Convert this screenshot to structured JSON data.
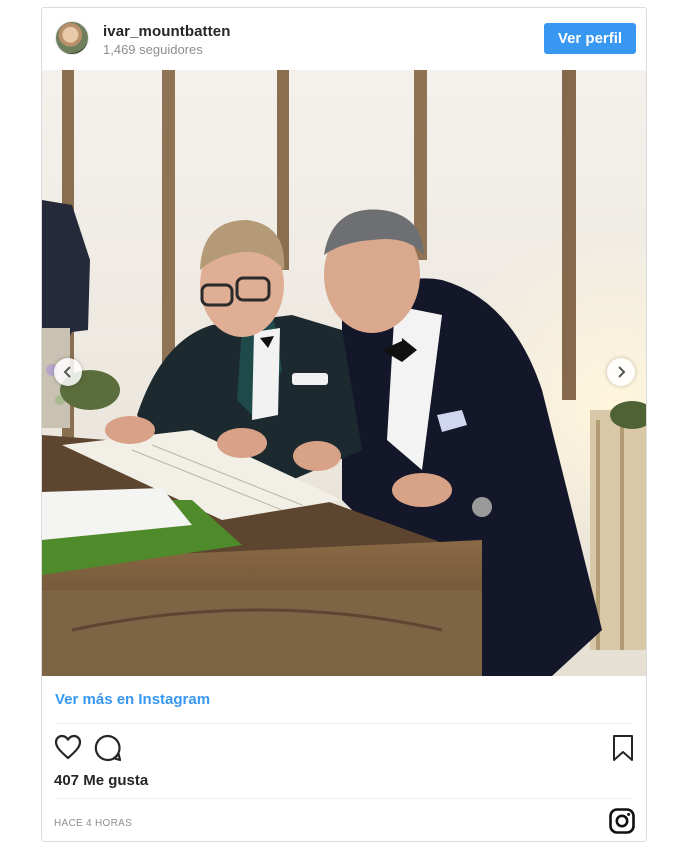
{
  "post": {
    "username": "ivar_mountbatten",
    "followers": "1,469 seguidores",
    "profile_button": "Ver perfil",
    "more_link": "Ver más en Instagram",
    "likes": "407 Me gusta",
    "timestamp": "HACE 4 HORAS"
  },
  "icons": {
    "avatar": "user-avatar",
    "prev": "chevron-left-icon",
    "next": "chevron-right-icon",
    "like": "heart-icon",
    "comment": "comment-icon",
    "save": "bookmark-icon",
    "brand": "instagram-icon"
  },
  "colors": {
    "accent": "#3897f0",
    "text": "#262626",
    "muted": "#8e8e8e",
    "border": "#dbdbdb"
  }
}
